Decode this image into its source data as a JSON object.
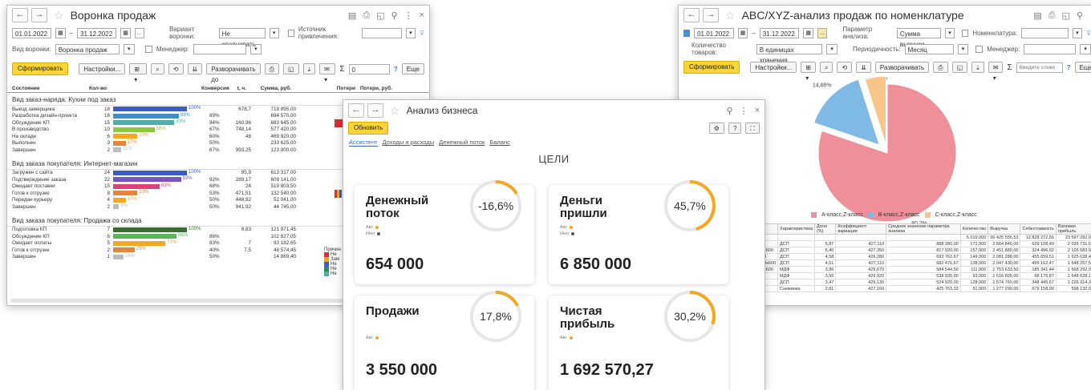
{
  "w1": {
    "title": "Воронка продаж",
    "date_from": "01.01.2022",
    "dash": "–",
    "date_to": "31.12.2022",
    "variant_label": "Вариант воронки:",
    "variant_value": "Не сравнивать",
    "source_label": "Источник привлечения:",
    "kind_label": "Вид воронки:",
    "kind_value": "Воронка продаж",
    "manager_label": "Менеджер:",
    "form_btn": "Сформировать",
    "settings_btn": "Настройки...",
    "expand_btn": "Разворачивать до",
    "sigma": "Σ",
    "sum_value": "0",
    "q": "?",
    "more_btn": "Еще",
    "headers": [
      "Состояние",
      "Кол-во",
      "Конверсия",
      "t, ч.",
      "Сумма, руб.",
      "Потери",
      "Потери, руб."
    ],
    "sections": [
      {
        "title": "Вид заказ-наряда: Кухни под заказ",
        "rows": [
          {
            "name": "Выезд замерщика",
            "count": "18",
            "pct": "100%",
            "conv": "",
            "t": "678,7",
            "sum": "719 895,00",
            "fill": 1.0,
            "color": "#3b5cc4"
          },
          {
            "name": "Разработка дизайн-проекта",
            "count": "16",
            "pct": "89%",
            "conv": "89%",
            "t": "",
            "sum": "694 570,00",
            "fill": 0.89,
            "color": "#3f8fcf"
          },
          {
            "name": "Обсуждение КП",
            "count": "15",
            "pct": "83%",
            "conv": "94%",
            "t": "160,96",
            "sum": "683 645,00",
            "fill": 0.83,
            "color": "#48b0a8"
          },
          {
            "name": "В производство",
            "count": "10",
            "pct": "56%",
            "conv": "67%",
            "t": "748,14",
            "sum": "577 420,00",
            "fill": 0.56,
            "color": "#8dc63f"
          },
          {
            "name": "На складе",
            "count": "6",
            "pct": "33%",
            "conv": "60%",
            "t": "48",
            "sum": "469 920,00",
            "fill": 0.33,
            "color": "#f5a623"
          },
          {
            "name": "Выполнен",
            "count": "3",
            "pct": "17%",
            "conv": "50%",
            "t": "",
            "sum": "233 625,00",
            "fill": 0.17,
            "color": "#e8843a"
          },
          {
            "name": "Завершен",
            "count": "2",
            "pct": "11%",
            "conv": "67%",
            "t": "993,25",
            "sum": "123 900,00",
            "fill": 0.11,
            "color": "#bbbbbb"
          }
        ]
      },
      {
        "title": "Вид заказа покупателя: Интернет-магазин",
        "rows": [
          {
            "name": "Загружен с сайта",
            "count": "24",
            "pct": "100%",
            "conv": "",
            "t": "95,9",
            "sum": "613 317,00",
            "fill": 1.0,
            "color": "#3b5cc4"
          },
          {
            "name": "Подтверждение заказа",
            "count": "22",
            "pct": "92%",
            "conv": "92%",
            "t": "289,17",
            "sum": "609 141,00",
            "fill": 0.92,
            "color": "#7a52c7"
          },
          {
            "name": "Ожидает поставки",
            "count": "15",
            "pct": "63%",
            "conv": "68%",
            "t": "24",
            "sum": "519 803,50",
            "fill": 0.63,
            "color": "#e0407a"
          },
          {
            "name": "Готов к отгрузке",
            "count": "8",
            "pct": "33%",
            "conv": "53%",
            "t": "471,51",
            "sum": "132 540,00",
            "fill": 0.33,
            "color": "#e8843a"
          },
          {
            "name": "Передан курьеру",
            "count": "4",
            "pct": "17%",
            "conv": "50%",
            "t": "448,92",
            "sum": "52 041,00",
            "fill": 0.17,
            "color": "#f5a623"
          },
          {
            "name": "Завершен",
            "count": "2",
            "pct": "8%",
            "conv": "50%",
            "t": "941,92",
            "sum": "44 745,00",
            "fill": 0.08,
            "color": "#bbbbbb"
          }
        ]
      },
      {
        "title": "Вид заказа покупателя: Продажа со склада",
        "rows": [
          {
            "name": "Подготовка КП",
            "count": "7",
            "pct": "100%",
            "conv": "",
            "t": "9,83",
            "sum": "121 971,45",
            "fill": 1.0,
            "color": "#3a6b35"
          },
          {
            "name": "Обсуждение КП",
            "count": "6",
            "pct": "86%",
            "conv": "86%",
            "t": "",
            "sum": "102 827,05",
            "fill": 0.86,
            "color": "#5bb55b"
          },
          {
            "name": "Ожидает оплаты",
            "count": "5",
            "pct": "71%",
            "conv": "83%",
            "t": "7",
            "sum": "93 182,65",
            "fill": 0.71,
            "color": "#f5a623"
          },
          {
            "name": "Готов к отгрузке",
            "count": "2",
            "pct": "29%",
            "conv": "40%",
            "t": "7,5",
            "sum": "48 574,45",
            "fill": 0.29,
            "color": "#e8843a"
          },
          {
            "name": "Завершен",
            "count": "1",
            "pct": "14%",
            "conv": "50%",
            "t": "",
            "sum": "14 869,40",
            "fill": 0.14,
            "color": "#bbbbbb"
          }
        ]
      }
    ],
    "reasons_label": "Причин",
    "reasons": [
      "Не",
      "Зам",
      "Не",
      "Не",
      "Не"
    ]
  },
  "w2": {
    "title": "ABC/XYZ-анализ продаж по номенклатуре",
    "date_from": "01.01.2022",
    "dash": "–",
    "date_to": "31.12.2022",
    "dots_btn": "...",
    "param_label": "Параметр анализа:",
    "param_value": "Сумма выручки",
    "nomen_label": "Номенклатура:",
    "qty_label": "Количество товаров:",
    "qty_value": "В единицах хранения",
    "period_label": "Периодичность:",
    "period_value": "Месяц",
    "manager_label": "Менеджер:",
    "form_btn": "Сформировать",
    "settings_btn": "Настройки...",
    "expand_btn": "Разворачивать до",
    "sigma": "Σ",
    "search_placeholder": "Введите слово",
    "q": "?",
    "more_btn": "Еще",
    "legend": [
      "A-класс,Z-класс",
      "B-класс,Z-класс",
      "C-класс,Z-класс"
    ],
    "table_headers": [
      "Характеристика",
      "Доля (%)",
      "Коэффициент вариации",
      "Среднее значение параметра анализа",
      "Количество",
      "Выручка",
      "Себестоимость",
      "Валовая прибыль"
    ],
    "totals": [
      "",
      "",
      "",
      "",
      "5 019,000",
      "36 425 555,53",
      "12 828 272,56",
      "23 597 282,97"
    ],
    "rows": [
      [
        "0",
        "ДСП",
        "5,87",
        "427,110",
        "888 280,00",
        "172,000",
        "2 664 840,00",
        "629 108,49",
        "2 035 731,51"
      ],
      [
        "0x600",
        "ДСП",
        "5,40",
        "427,350",
        "817 920,00",
        "157,000",
        "2 451 880,00",
        "324 496,02",
        "2 126 583,98"
      ],
      [
        "00",
        "ДСП",
        "4,58",
        "426,280",
        "693 762,67",
        "149,000",
        "2 081 288,00",
        "455 659,51",
        "1 625 628,49"
      ],
      [
        "00x600",
        "ДСП",
        "4,51",
        "427,110",
        "682 476,67",
        "138,000",
        "2 047 430,00",
        "499 162,47",
        "1 548 267,53"
      ],
      [
        "0x600",
        "МДФ",
        "3,86",
        "429,670",
        "584 544,50",
        "111,000",
        "1 753 633,50",
        "185 341,44",
        "1 568 292,06"
      ],
      [
        "0",
        "МДФ",
        "3,56",
        "429,920",
        "538 935,00",
        "93,000",
        "1 616 805,00",
        "68 176,87",
        "1 548 628,13"
      ],
      [
        "",
        "ДСП",
        "3,47",
        "429,130",
        "524 920,00",
        "128,000",
        "1 574 760,00",
        "348 445,67",
        "1 226 314,33"
      ],
      [
        "",
        "Снежинка",
        "2,81",
        "427,160",
        "425 763,33",
        "51,000",
        "1 277 290,00",
        "679 158,00",
        "598 132,00"
      ]
    ],
    "chart_data": {
      "type": "pie",
      "categories": [
        "A-класс,Z-класс",
        "B-класс,Z-класс",
        "C-класс,Z-класс"
      ],
      "values": [
        80.2,
        14.88,
        4.92
      ],
      "labels": [
        "80,2%",
        "14,88%",
        "4,92%"
      ],
      "colors": [
        "#ef8f9a",
        "#7fb9e6",
        "#f7c587"
      ],
      "legend_position": "bottom"
    }
  },
  "w3": {
    "title": "Анализ бизнеса",
    "refresh_btn": "Обновить",
    "tabs": [
      "Ассистент",
      "Доходы и расходы",
      "Денежный поток",
      "Баланс"
    ],
    "goals_title": "ЦЕЛИ",
    "q": "?",
    "legend_aug": "Авг",
    "legend_jul": "Июл",
    "cards": [
      {
        "title_l1": "Денежный",
        "title_l2": "поток",
        "pct": "-16,6%",
        "value": "654 000",
        "progress": 0.166,
        "two": true
      },
      {
        "title_l1": "Деньги",
        "title_l2": "пришли",
        "pct": "45,7%",
        "value": "6 850 000",
        "progress": 0.457,
        "two": true
      },
      {
        "title_l1": "Продажи",
        "title_l2": "",
        "pct": "17,8%",
        "value": "3 550 000",
        "progress": 0.178,
        "two": false
      },
      {
        "title_l1": "Чистая",
        "title_l2": "прибыль",
        "pct": "30,2%",
        "value": "1 692 570,27",
        "progress": 0.302,
        "two": false
      }
    ],
    "colors": {
      "accent": "#f5a623",
      "grey": "#555555",
      "track": "#e6e6e6"
    }
  }
}
